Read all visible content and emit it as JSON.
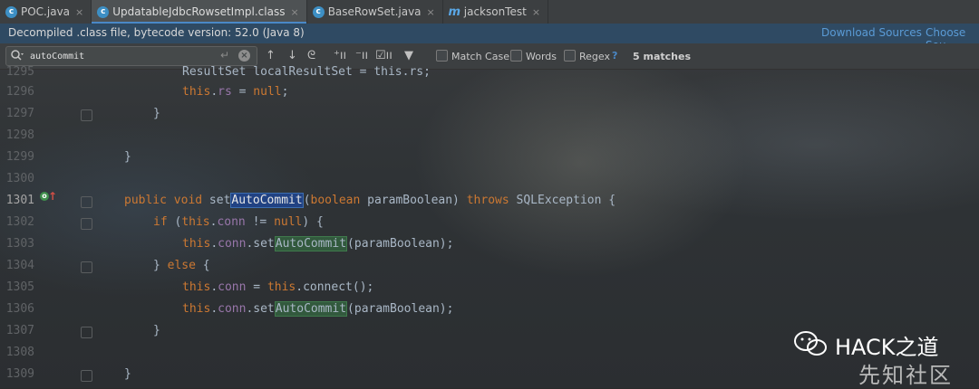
{
  "tabs": [
    {
      "icon": "class-c-icon",
      "label": "POC.java",
      "active": false
    },
    {
      "icon": "class-c-icon",
      "label": "UpdatableJdbcRowsetImpl.class",
      "active": true
    },
    {
      "icon": "class-c-icon",
      "label": "BaseRowSet.java",
      "active": false
    },
    {
      "icon": "method-m-icon",
      "label": "jacksonTest",
      "active": false
    }
  ],
  "tab_close": "×",
  "notice": {
    "text": "Decompiled .class file, bytecode version: 52.0 (Java 8)",
    "download_sources": "Download Sources",
    "choose_sources": "Choose Sou"
  },
  "search": {
    "value": "autoCommit",
    "match_case": "Match Case",
    "words": "Words",
    "regex": "Regex",
    "help": "?",
    "matches": "5 matches"
  },
  "lines": [
    {
      "num": "1295",
      "code": "ResultSet localResultSet = this.rs;"
    },
    {
      "num": "1296",
      "code": "this.rs = null;"
    },
    {
      "num": "1297",
      "code": "}"
    },
    {
      "num": "1298",
      "code": ""
    },
    {
      "num": "1299",
      "code": "}"
    },
    {
      "num": "1300",
      "code": ""
    },
    {
      "num": "1301",
      "code": "public void setAutoCommit(boolean paramBoolean) throws SQLException {"
    },
    {
      "num": "1302",
      "code": "if (this.conn != null) {"
    },
    {
      "num": "1303",
      "code": "this.conn.setAutoCommit(paramBoolean);"
    },
    {
      "num": "1304",
      "code": "} else {"
    },
    {
      "num": "1305",
      "code": "this.conn = this.connect();"
    },
    {
      "num": "1306",
      "code": "this.conn.setAutoCommit(paramBoolean);"
    },
    {
      "num": "1307",
      "code": "}"
    },
    {
      "num": "1308",
      "code": ""
    },
    {
      "num": "1309",
      "code": "}"
    }
  ],
  "watermark": {
    "title": "HACK之道",
    "subtitle": "先知社区"
  },
  "colors": {
    "keyword": "#cc7832",
    "field": "#9876aa",
    "text": "#a9b7c6",
    "current_match": "#214283",
    "other_match": "#32593d",
    "link": "#5a9bd6"
  }
}
